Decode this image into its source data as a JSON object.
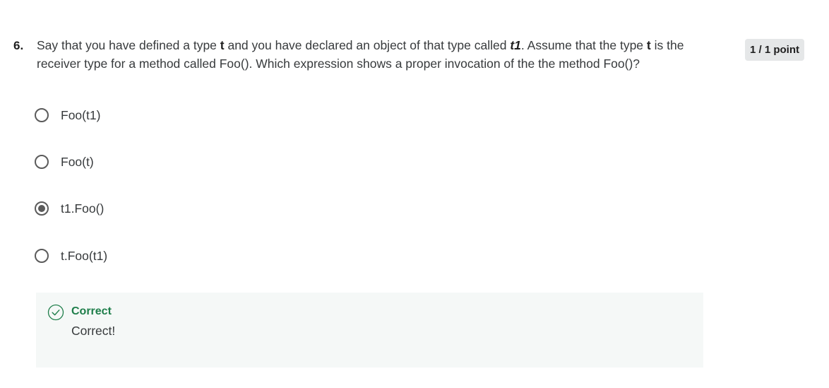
{
  "question": {
    "number": "6.",
    "text_part1": "Say that you have defined a type ",
    "bold_t_1": "t",
    "text_part2": " and you have declared an object of that type called ",
    "bold_t1": "t1",
    "text_part3": ". Assume that the type ",
    "bold_t_2": "t",
    "text_part4": " is the receiver type for a method called Foo(). Which expression shows a proper invocation of the the method Foo()?",
    "points": "1 / 1 point"
  },
  "options": [
    {
      "label": "Foo(t1)",
      "selected": false
    },
    {
      "label": "Foo(t)",
      "selected": false
    },
    {
      "label": "t1.Foo()",
      "selected": true
    },
    {
      "label": "t.Foo(t1)",
      "selected": false
    }
  ],
  "feedback": {
    "title": "Correct",
    "message": "Correct!",
    "icon": "check-circle-icon",
    "color": "#1e7e4a"
  }
}
